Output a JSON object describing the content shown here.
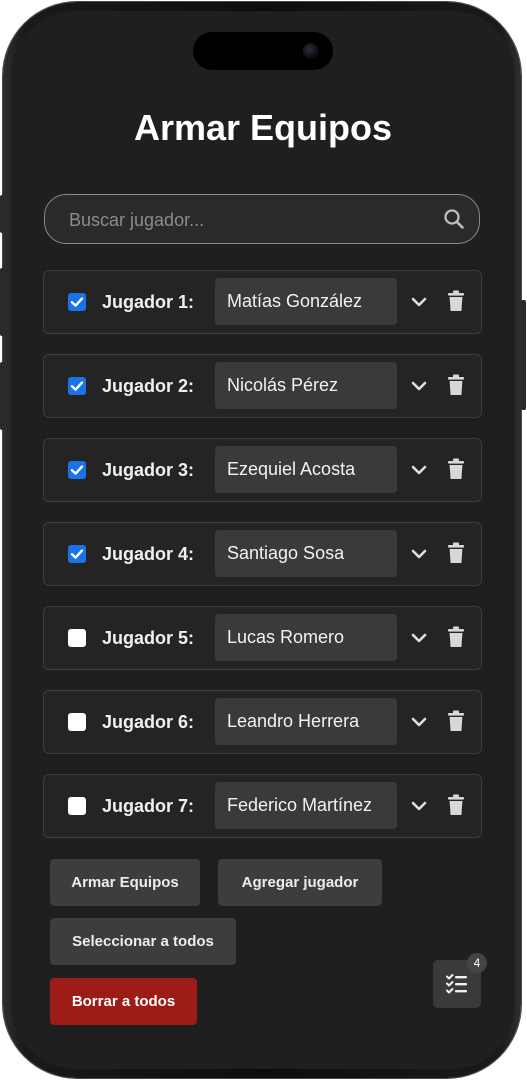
{
  "app": {
    "title": "Armar Equipos"
  },
  "search": {
    "placeholder": "Buscar jugador..."
  },
  "players": [
    {
      "label": "Jugador 1:",
      "name": "Matías González",
      "checked": true
    },
    {
      "label": "Jugador 2:",
      "name": "Nicolás Pérez",
      "checked": true
    },
    {
      "label": "Jugador 3:",
      "name": "Ezequiel Acosta",
      "checked": true
    },
    {
      "label": "Jugador 4:",
      "name": "Santiago Sosa",
      "checked": true
    },
    {
      "label": "Jugador 5:",
      "name": "Lucas Romero",
      "checked": false
    },
    {
      "label": "Jugador 6:",
      "name": "Leandro Herrera",
      "checked": false
    },
    {
      "label": "Jugador 7:",
      "name": "Federico Martínez",
      "checked": false
    }
  ],
  "actions": {
    "armar": "Armar Equipos",
    "agregar": "Agregar jugador",
    "seleccionar": "Seleccionar a todos",
    "borrar": "Borrar a todos"
  },
  "fab": {
    "badge": "4",
    "icon": "checklist-icon"
  },
  "icons": {
    "search": "search-icon",
    "chevron": "chevron-down-icon",
    "trash": "trash-icon",
    "checkbox": "checkbox"
  },
  "colors": {
    "background": "#1f1f1f",
    "checkbox_checked": "#1a73e8",
    "danger": "#9e1c17"
  }
}
